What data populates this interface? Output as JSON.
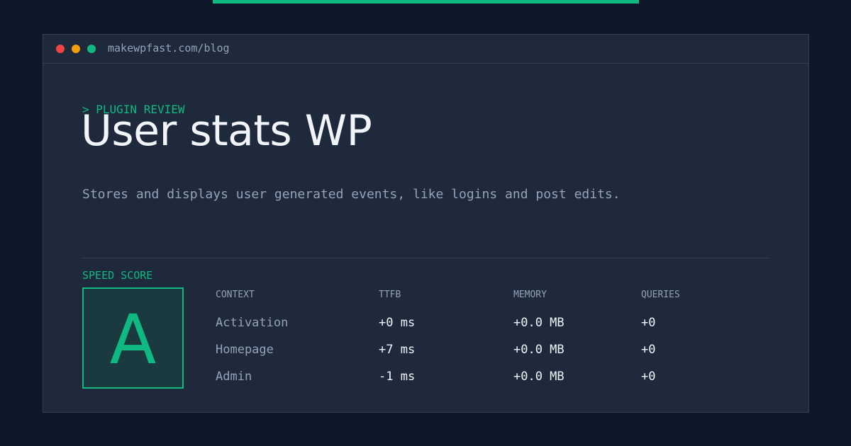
{
  "url": "makewpfast.com/blog",
  "kicker": "> PLUGIN REVIEW",
  "title": "User stats WP",
  "description": "Stores and displays user generated events, like logins and post edits.",
  "score_label": "SPEED SCORE",
  "grade": "A",
  "colors": {
    "accent": "#10b981",
    "background": "#0f172a",
    "panel": "#1e293b"
  },
  "table": {
    "headers": [
      "CONTEXT",
      "TTFB",
      "MEMORY",
      "QUERIES"
    ],
    "rows": [
      {
        "context": "Activation",
        "ttfb": "+0 ms",
        "memory": "+0.0 MB",
        "queries": "+0"
      },
      {
        "context": "Homepage",
        "ttfb": "+7 ms",
        "memory": "+0.0 MB",
        "queries": "+0"
      },
      {
        "context": "Admin",
        "ttfb": "-1 ms",
        "memory": "+0.0 MB",
        "queries": "+0"
      }
    ]
  }
}
